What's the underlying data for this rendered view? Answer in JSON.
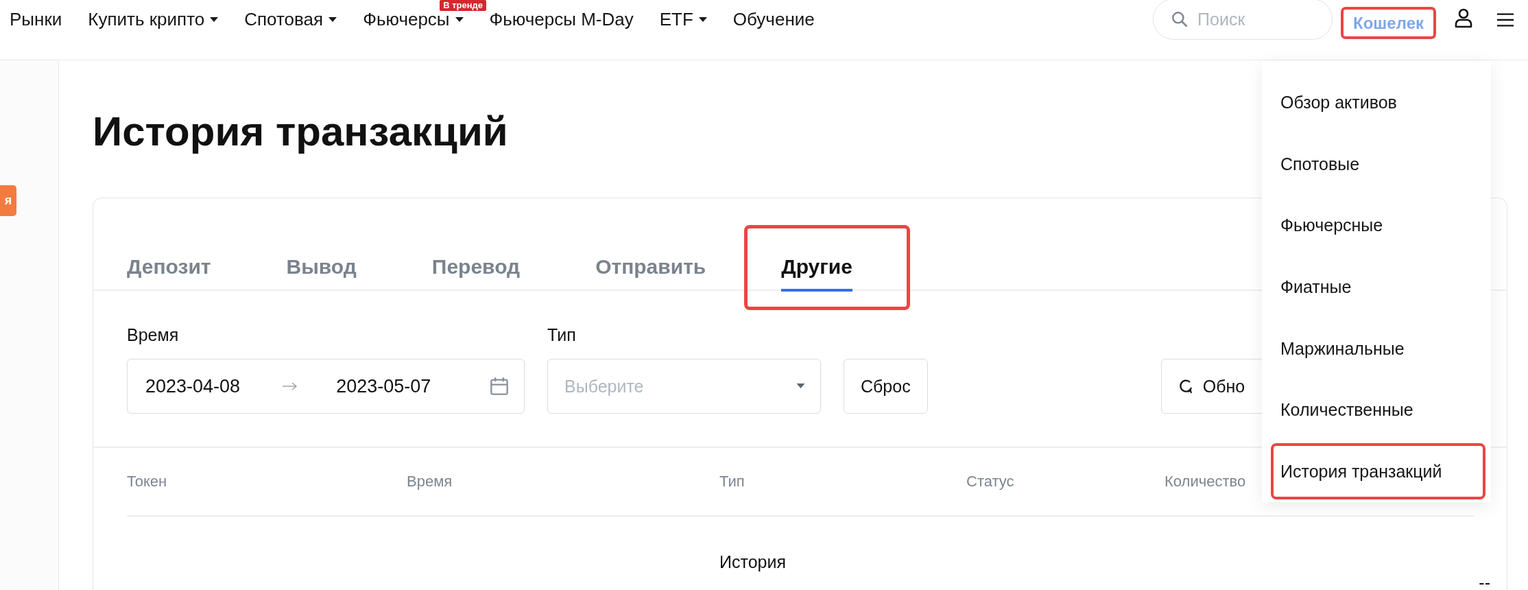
{
  "nav": {
    "items": [
      {
        "label": "Рынки",
        "dropdown": false
      },
      {
        "label": "Купить крипто",
        "dropdown": true
      },
      {
        "label": "Спотовая",
        "dropdown": true
      },
      {
        "label": "Фьючерсы",
        "dropdown": true,
        "badge": "В тренде"
      },
      {
        "label": "Фьючерсы M-Day",
        "dropdown": false
      },
      {
        "label": "ETF",
        "dropdown": true
      },
      {
        "label": "Обучение",
        "dropdown": false
      }
    ],
    "search": {
      "placeholder": "Поиск"
    },
    "wallet": {
      "label": "Кошелек",
      "highlighted": true
    }
  },
  "sidebar": {
    "badge": "я"
  },
  "page_title": "История транзакций",
  "tabs": [
    {
      "label": "Депозит",
      "selected": false,
      "highlighted": false
    },
    {
      "label": "Вывод",
      "selected": false,
      "highlighted": false
    },
    {
      "label": "Перевод",
      "selected": false,
      "highlighted": false
    },
    {
      "label": "Отправить",
      "selected": false,
      "highlighted": false
    },
    {
      "label": "Другие",
      "selected": true,
      "highlighted": true
    }
  ],
  "filters": {
    "time_label": "Время",
    "date_from": "2023-04-08",
    "date_to": "2023-05-07",
    "type_label": "Тип",
    "type_placeholder": "Выберите",
    "reset_button": "Сброс",
    "refresh_button": "Обно"
  },
  "table": {
    "columns": [
      "Токен",
      "Время",
      "Тип",
      "Статус",
      "Количество"
    ],
    "rows": [
      {
        "type": "История",
        "column_6": "--"
      }
    ]
  },
  "wallet_menu": {
    "items": [
      {
        "label": "Обзор активов",
        "highlighted": false
      },
      {
        "label": "Спотовые",
        "highlighted": false
      },
      {
        "label": "Фьючерсные",
        "highlighted": false
      },
      {
        "label": "Фиатные",
        "highlighted": false
      },
      {
        "label": "Маржинальные",
        "highlighted": false
      },
      {
        "label": "Количественные",
        "highlighted": false
      },
      {
        "label": "История транзакций",
        "highlighted": true
      }
    ]
  }
}
